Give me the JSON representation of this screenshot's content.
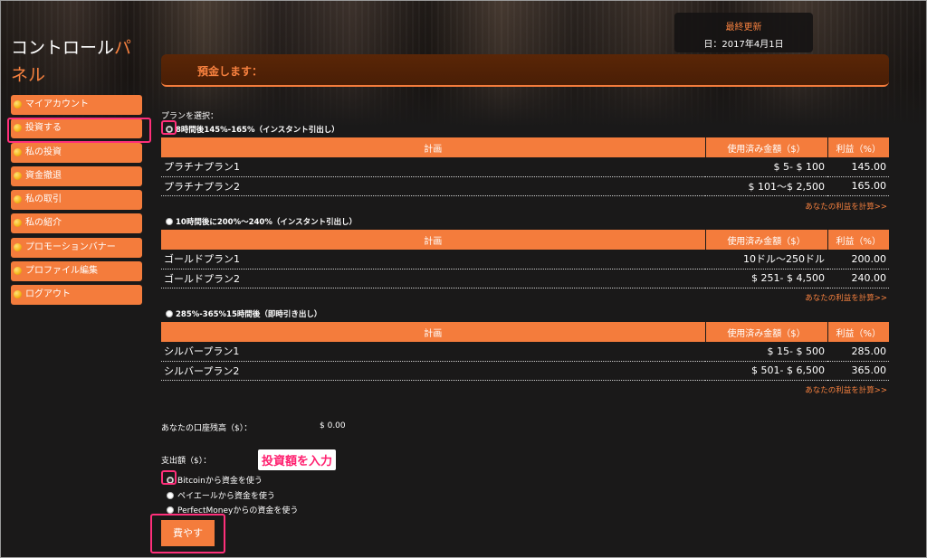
{
  "sidebar": {
    "title_main": "コントロール",
    "title_accent": "パネル",
    "items": [
      {
        "label": "マイアカウント"
      },
      {
        "label": "投資する"
      },
      {
        "label": "私の投資"
      },
      {
        "label": "資金撤退"
      },
      {
        "label": "私の取引"
      },
      {
        "label": "私の紹介"
      },
      {
        "label": "プロモーションバナー"
      },
      {
        "label": "プロファイル編集"
      },
      {
        "label": "ログアウト"
      }
    ]
  },
  "updated": {
    "label": "最終更新",
    "value": "日：2017年4月1日"
  },
  "header": {
    "title": "預金します："
  },
  "select_plan_label": "プランを選択：",
  "columns": {
    "plan": "計画",
    "amount": "使用済み金額（$）",
    "profit": "利益（%）"
  },
  "calc_link": "あなたの利益を計算>>",
  "plan_groups": [
    {
      "label": "8時間後145%-165%（インスタント引出し）",
      "selected": true,
      "rows": [
        {
          "plan": "プラチナプラン1",
          "amount": "$ 5- $ 100",
          "profit": "145.00"
        },
        {
          "plan": "プラチナプラン2",
          "amount": "$ 101～$ 2,500",
          "profit": "165.00"
        }
      ]
    },
    {
      "label": "10時間後に200%～240%（インスタント引出し）",
      "selected": false,
      "rows": [
        {
          "plan": "ゴールドプラン1",
          "amount": "10ドル～250ドル",
          "profit": "200.00"
        },
        {
          "plan": "ゴールドプラン2",
          "amount": "$ 251- $ 4,500",
          "profit": "240.00"
        }
      ]
    },
    {
      "label": "285%-365%15時間後（即時引き出し）",
      "selected": false,
      "rows": [
        {
          "plan": "シルバープラン1",
          "amount": "$ 15- $ 500",
          "profit": "285.00"
        },
        {
          "plan": "シルバープラン2",
          "amount": "$ 501- $ 6,500",
          "profit": "365.00"
        }
      ]
    }
  ],
  "balance": {
    "label": "あなたの口座残高（$）：",
    "value": "$ 0.00"
  },
  "amount": {
    "label": "支出額（$）：",
    "annotation": "投資額を入力"
  },
  "payment_options": [
    {
      "label": "Bitcoinから資金を使う",
      "selected": true
    },
    {
      "label": "ペイエールから資金を使う",
      "selected": false
    },
    {
      "label": "PerfectMoneyからの資金を使う",
      "selected": false
    }
  ],
  "spend_button": "費やす",
  "colors": {
    "accent": "#f47c3c",
    "highlight": "#ff2f7a",
    "background": "#1a1919"
  }
}
